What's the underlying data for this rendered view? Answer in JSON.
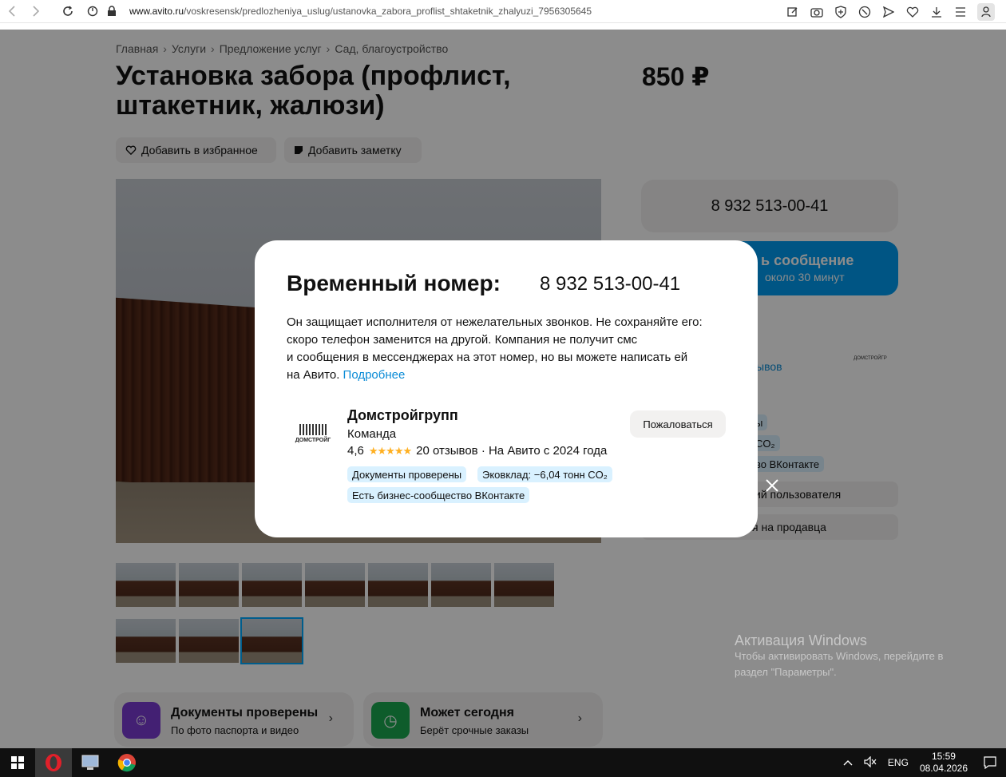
{
  "browser": {
    "url_domain": "www.avito.ru",
    "url_path": "/voskresensk/predlozheniya_uslug/ustanovka_zabora_proflist_shtaketnik_zhalyuzi_7956305645"
  },
  "breadcrumbs": [
    "Главная",
    "Услуги",
    "Предложение услуг",
    "Сад, благоустройство"
  ],
  "listing": {
    "title": "Установка забора (профлист, штакетник, жалюзи)",
    "price": "850 ₽",
    "favorite_label": "Добавить в избранное",
    "note_label": "Добавить заметку"
  },
  "sidebar": {
    "phone": "8 932 513-00-41",
    "message_line1": "ь сообщение",
    "message_line2": "около 30 минут",
    "reviews_link": "ывов",
    "badge1": "ы",
    "badge2": "CO₂",
    "badge3": "во ВКонтакте",
    "row1": "ий пользователя",
    "row2": "ся на продавца",
    "logo_text": "ДОМСТРОЙГР"
  },
  "features": [
    {
      "title": "Документы проверены",
      "subtitle": "По фото паспорта и видео",
      "color": "#7a3bd1"
    },
    {
      "title": "Может сегодня",
      "subtitle": "Берёт срочные заказы",
      "color": "#1aa84f"
    }
  ],
  "modal": {
    "title": "Временный номер:",
    "phone": "8 932 513-00-41",
    "text_line1": "Он защищает исполнителя от нежелательных звонков. Не сохраняйте его:",
    "text_line2": "скоро телефон заменится на другой. Компания не получит смс",
    "text_line3": "и сообщения в мессенджерах на этот номер, но вы можете написать ей",
    "text_line4": "на Авито.",
    "more_link": "Подробнее",
    "company": "Домстройгрупп",
    "company_type": "Команда",
    "rating": "4,6",
    "reviews": "20 отзывов · На Авито с 2024 года",
    "badge_docs": "Документы проверены",
    "badge_eco": "Эковклад: −6,04 тонн CO₂",
    "badge_vk": "Есть бизнес-сообщество ВКонтакте",
    "report_label": "Пожаловаться",
    "logo_text": "ДОМСТРОЙГ"
  },
  "watermark": {
    "title": "Активация Windows",
    "line1": "Чтобы активировать Windows, перейдите в",
    "line2": "раздел \"Параметры\"."
  },
  "taskbar": {
    "lang": "ENG",
    "time": "15:59",
    "date": "08.04.2026"
  }
}
